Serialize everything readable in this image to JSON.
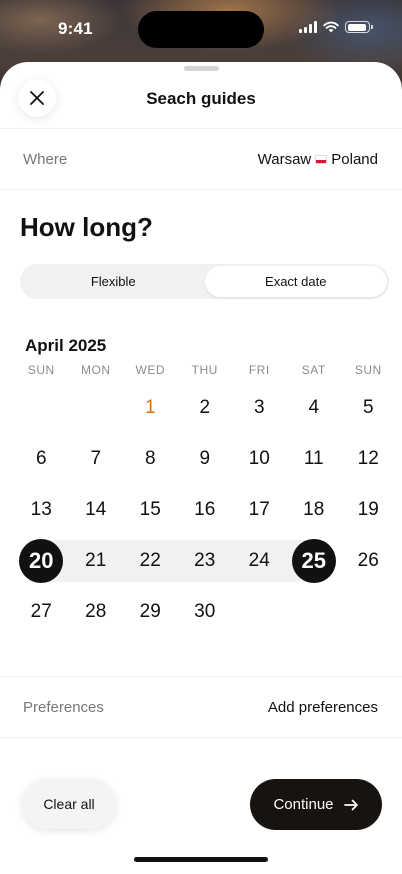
{
  "status_bar": {
    "time": "9:41",
    "battery_level": 0.9
  },
  "sheet": {
    "title": "Seach guides"
  },
  "where": {
    "label": "Where",
    "value_city": "Warsaw",
    "value_country": "Poland"
  },
  "headline": "How long?",
  "segmented": {
    "options": [
      "Flexible",
      "Exact date"
    ],
    "selected": "Exact date"
  },
  "calendar": {
    "month_label": "April 2025",
    "weekdays": [
      "SUN",
      "MON",
      "WED",
      "THU",
      "FRI",
      "SAT",
      "SUN"
    ],
    "weeks": [
      [
        null,
        null,
        "1",
        "2",
        "3",
        "4",
        "5"
      ],
      [
        "6",
        "7",
        "8",
        "9",
        "10",
        "11",
        "12"
      ],
      [
        "13",
        "14",
        "15",
        "16",
        "17",
        "18",
        "19"
      ],
      [
        "20",
        "21",
        "22",
        "23",
        "24",
        "25",
        "26"
      ],
      [
        "27",
        "28",
        "29",
        "30",
        null,
        null,
        null
      ]
    ],
    "today": "1",
    "range_start": "20",
    "range_end": "25"
  },
  "preferences": {
    "label": "Preferences",
    "action": "Add preferences"
  },
  "footer": {
    "clear_label": "Clear all",
    "continue_label": "Continue"
  },
  "colors": {
    "accent_today": "#d9730d",
    "primary_button": "#161310",
    "selected_day": "#111111"
  }
}
